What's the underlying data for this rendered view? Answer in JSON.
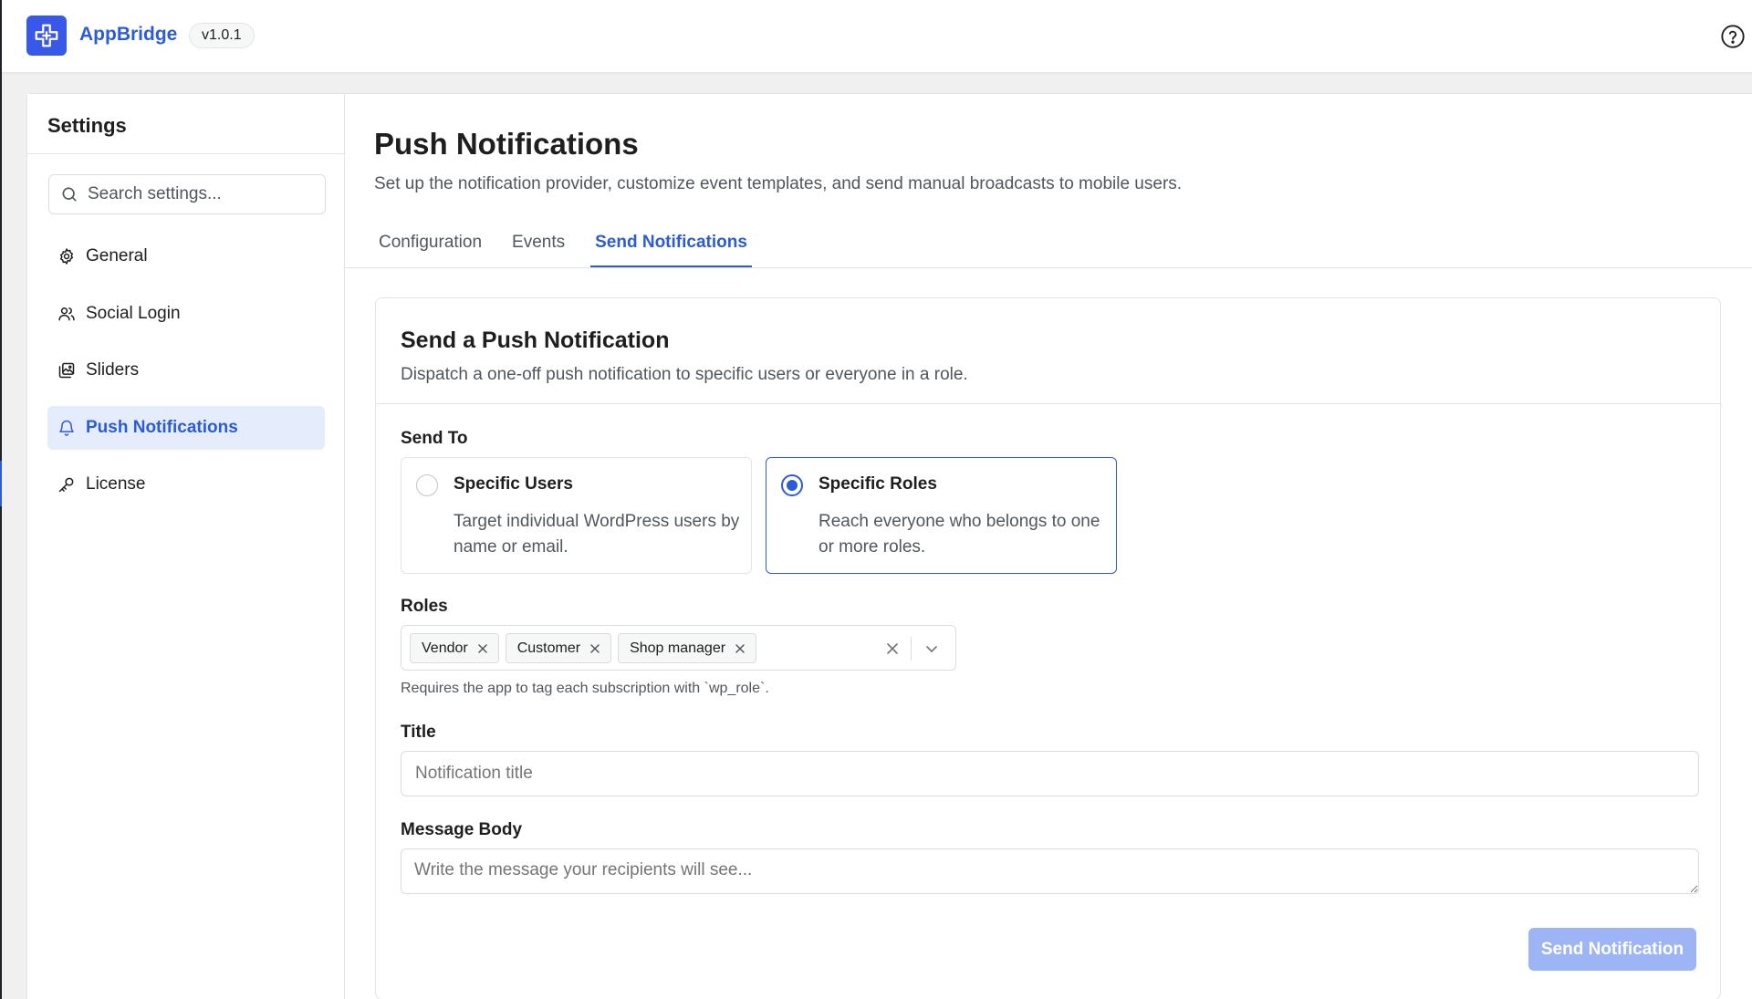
{
  "app": {
    "brand": "AppBridge",
    "version": "v1.0.1"
  },
  "icons": {
    "logo": "appbridge-logo-icon",
    "help": "help-circle-icon",
    "search": "search-icon"
  },
  "sidebar": {
    "title": "Settings",
    "search_placeholder": "Search settings...",
    "items": [
      {
        "label": "General",
        "icon": "gear-icon",
        "active": false
      },
      {
        "label": "Social Login",
        "icon": "users-icon",
        "active": false
      },
      {
        "label": "Sliders",
        "icon": "images-icon",
        "active": false
      },
      {
        "label": "Push Notifications",
        "icon": "bell-icon",
        "active": true
      },
      {
        "label": "License",
        "icon": "key-icon",
        "active": false
      }
    ]
  },
  "page": {
    "title": "Push Notifications",
    "description": "Set up the notification provider, customize event templates, and send manual broadcasts to mobile users.",
    "tabs": [
      {
        "label": "Configuration",
        "active": false
      },
      {
        "label": "Events",
        "active": false
      },
      {
        "label": "Send Notifications",
        "active": true
      }
    ]
  },
  "form": {
    "title": "Send a Push Notification",
    "description": "Dispatch a one-off push notification to specific users or everyone in a role.",
    "send_to_label": "Send To",
    "options": [
      {
        "title": "Specific Users",
        "description": "Target individual WordPress users by name or email.",
        "selected": false
      },
      {
        "title": "Specific Roles",
        "description": "Reach everyone who belongs to one or more roles.",
        "selected": true
      }
    ],
    "roles_label": "Roles",
    "roles": [
      "Vendor",
      "Customer",
      "Shop manager"
    ],
    "roles_help": "Requires the app to tag each subscription with `wp_role`.",
    "title_label": "Title",
    "title_placeholder": "Notification title",
    "title_value": "",
    "body_label": "Message Body",
    "body_placeholder": "Write the message your recipients will see...",
    "body_value": "",
    "submit_label": "Send Notification"
  },
  "colors": {
    "accent": "#2c5bd6",
    "logo_bg": "#3858e9",
    "active_nav_bg": "#e5ecfc",
    "submit_disabled": "#9db5f5"
  }
}
